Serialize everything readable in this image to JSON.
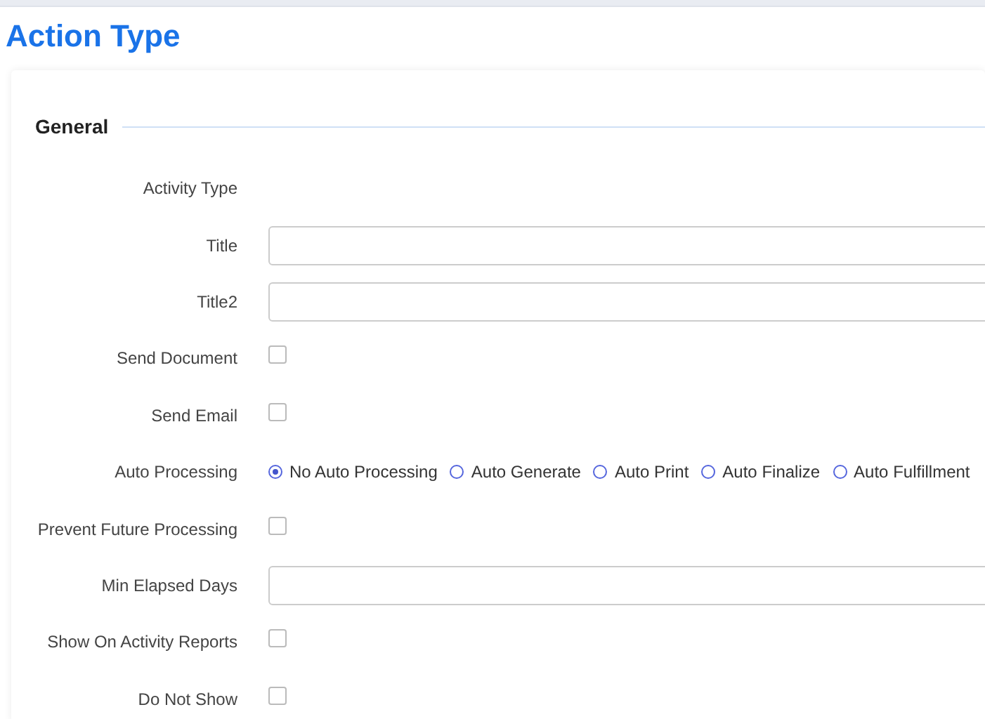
{
  "page": {
    "title": "Action Type"
  },
  "section": {
    "title": "General"
  },
  "fields": [
    {
      "kind": "static",
      "label": "Activity Type"
    },
    {
      "kind": "input",
      "label": "Title"
    },
    {
      "kind": "input",
      "label": "Title2"
    },
    {
      "kind": "checkbox",
      "label": "Send Document",
      "checked": false
    },
    {
      "kind": "checkbox",
      "label": "Send Email",
      "checked": false
    },
    {
      "kind": "radio",
      "label": "Auto Processing",
      "options": [
        {
          "label": "No Auto Processing",
          "selected": true
        },
        {
          "label": "Auto Generate",
          "selected": false
        },
        {
          "label": "Auto Print",
          "selected": false
        },
        {
          "label": "Auto Finalize",
          "selected": false
        },
        {
          "label": "Auto Fulfillment",
          "selected": false
        }
      ]
    },
    {
      "kind": "checkbox",
      "label": "Prevent Future Processing",
      "checked": false
    },
    {
      "kind": "input",
      "label": "Min Elapsed Days"
    },
    {
      "kind": "checkbox",
      "label": "Show On Activity Reports",
      "checked": false
    },
    {
      "kind": "checkbox",
      "label": "Do Not Show",
      "checked": false
    }
  ]
}
